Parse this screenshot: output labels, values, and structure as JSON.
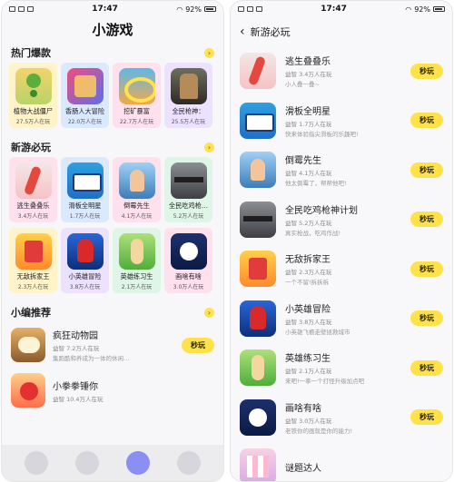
{
  "status": {
    "time": "17:47",
    "battery": "92%"
  },
  "left": {
    "title": "小游戏",
    "hot": {
      "heading": "热门爆款",
      "items": [
        {
          "name": "植物大战僵尸",
          "count": "27.5万人在玩",
          "icon": "plant-game-icon"
        },
        {
          "name": "香肠人大冒险",
          "count": "22.0万人在玩",
          "icon": "sausage-game-icon"
        },
        {
          "name": "挖矿暴富",
          "count": "22.7万人在玩",
          "icon": "mining-game-icon"
        },
        {
          "name": "全民枪神：",
          "count": "25.5万人在玩",
          "icon": "gun-game-icon"
        }
      ]
    },
    "new": {
      "heading": "新游必玩",
      "row1": [
        {
          "name": "逃生叠叠乐",
          "count": "3.4万人在玩"
        },
        {
          "name": "滑板全明星",
          "count": "1.7万人在玩"
        },
        {
          "name": "倒霉先生",
          "count": "4.1万人在玩"
        },
        {
          "name": "全民吃鸡枪…",
          "count": "5.2万人在玩"
        }
      ],
      "row2": [
        {
          "name": "无敌拆家王",
          "count": "2.3万人在玩"
        },
        {
          "name": "小英雄冒险",
          "count": "3.8万人在玩"
        },
        {
          "name": "英雄练习生",
          "count": "2.1万人在玩"
        },
        {
          "name": "画啥有啥",
          "count": "3.0万人在玩"
        }
      ]
    },
    "recommend": {
      "heading": "小编推荐",
      "items": [
        {
          "name": "疯狂动物园",
          "sub": "益智  7.2万人在玩",
          "desc": "集跑酷和养成为一体的休闲…",
          "button": "秒玩"
        },
        {
          "name": "小拳拳锤你",
          "sub": "益智  10.4万人在玩",
          "desc": "",
          "button": "秒玩"
        }
      ]
    },
    "more_icon": "›"
  },
  "right": {
    "back_icon": "‹",
    "title": "新游必玩",
    "items": [
      {
        "name": "逃生叠叠乐",
        "sub": "益智  3.4万人在玩",
        "desc": "小人叠一叠~",
        "button": "秒玩"
      },
      {
        "name": "滑板全明星",
        "sub": "益智  1.7万人在玩",
        "desc": "快来体验指尖滑板的乐趣吧!",
        "button": "秒玩"
      },
      {
        "name": "倒霉先生",
        "sub": "益智  4.1万人在玩",
        "desc": "他太倒霉了，帮帮他吧!",
        "button": "秒玩"
      },
      {
        "name": "全民吃鸡枪神计划",
        "sub": "益智  5.2万人在玩",
        "desc": "真实枪战，吃鸡作战!",
        "button": "秒玩"
      },
      {
        "name": "无敌拆家王",
        "sub": "益智  2.3万人在玩",
        "desc": "一个不留!拆拆拆",
        "button": "秒玩"
      },
      {
        "name": "小英雄冒险",
        "sub": "益智  3.8万人在玩",
        "desc": "小英雄飞檐走壁拯救城市",
        "button": "秒玩"
      },
      {
        "name": "英雄练习生",
        "sub": "益智  2.1万人在玩",
        "desc": "来吧!一拳一个打怪升级加点吧",
        "button": "秒玩"
      },
      {
        "name": "画啥有啥",
        "sub": "益智  3.0万人在玩",
        "desc": "老铁你的画就是你的能力!",
        "button": "秒玩"
      },
      {
        "name": "谜题达人",
        "sub": "",
        "desc": "",
        "button": ""
      }
    ]
  }
}
